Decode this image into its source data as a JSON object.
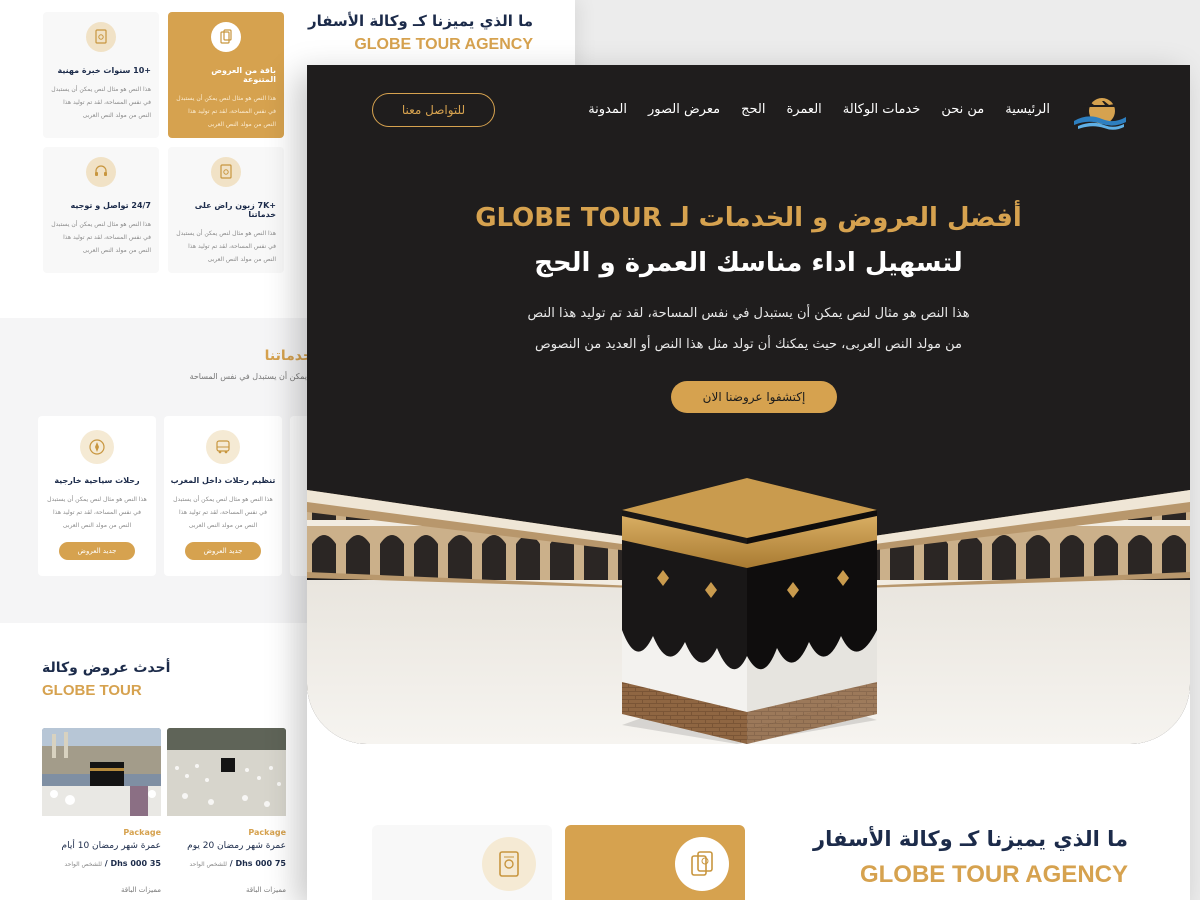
{
  "colors": {
    "gold": "#d6a24f",
    "navy": "#1c2b4a",
    "hero_bg": "#1f1d1d"
  },
  "back_page": {
    "why": {
      "title": "ما الذي يميزنا كـ وكالة الأسفار",
      "brand": "GLOBE TOUR AGENCY"
    },
    "features": [
      {
        "title": "+10  سنوات خبرة مهنية",
        "desc": "هذا النص هو مثال لنص يمكن أن يستبدل في نفس المساحة، لقد تم توليد هذا النص من مولد النص العربى",
        "icon": "certificate-icon"
      },
      {
        "title": "باقة من العروض المتنوعة",
        "desc": "هذا النص هو مثال لنص يمكن أن يستبدل في نفس المساحة، لقد تم توليد هذا النص من مولد النص العربى",
        "icon": "travel-docs-icon"
      },
      {
        "title": "24/7  تواصل و توجيه",
        "desc": "هذا النص هو مثال لنص يمكن أن يستبدل في نفس المساحة، لقد تم توليد هذا النص من مولد النص العربى",
        "icon": "support-headset-icon"
      },
      {
        "title": "+7K  زبون راض على خدماتنا",
        "desc": "هذا النص هو مثال لنص يمكن أن يستبدل في نفس المساحة، لقد تم توليد هذا النص من مولد النص العربى",
        "icon": "certificate-icon"
      }
    ],
    "services": {
      "title": "خدماتنا",
      "subtitle": "يمكن أن يستبدل في نفس المساحة",
      "items": [
        {
          "title": "رحلات سياحية خارجية",
          "desc": "هذا النص هو مثال لنص يمكن أن يستبدل في نفس المساحة، لقد تم توليد هذا النص من مولد النص العربى",
          "button": "جديد العروض",
          "icon": "compass-icon"
        },
        {
          "title": "تنظيم رحلات داخل المغرب",
          "desc": "هذا النص هو مثال لنص يمكن أن يستبدل في نفس المساحة، لقد تم توليد هذا النص من مولد النص العربى",
          "button": "جديد العروض",
          "icon": "bus-icon"
        }
      ]
    },
    "latest": {
      "title": "أحدث عروض وكالة",
      "brand": "GLOBE TOUR",
      "packages": [
        {
          "tag": "Package",
          "title": "عمرة شهر رمضان 10 أيام",
          "price": "35 000 Dhs /",
          "price_note": "للشخص الواحد",
          "footer": "مميزات الباقة"
        },
        {
          "tag": "Package",
          "title": "عمرة شهر رمضان 20 يوم",
          "price": "75 000 Dhs /",
          "price_note": "للشخص الواحد",
          "footer": "مميزات الباقة"
        }
      ]
    }
  },
  "front_page": {
    "logo": "globe-tour-logo",
    "nav": [
      "الرئيسية",
      "من نحن",
      "خدمات الوكالة",
      "العمرة",
      "الحج",
      "معرض الصور",
      "المدونة"
    ],
    "contact_button": "للتواصل معنا",
    "hero": {
      "title_line1": "أفضل العروض و الخدمات لـ GLOBE TOUR",
      "title_line2": "لتسهيل اداء مناسك العمرة و الحج",
      "desc_line1": "هذا النص هو مثال لنص يمكن أن يستبدل في نفس المساحة، لقد تم توليد هذا النص",
      "desc_line2": "من مولد النص العربى، حيث يمكنك أن تولد مثل هذا النص أو العديد من النصوص",
      "cta": "إكتشفوا عروضنا الان"
    },
    "why": {
      "title": "ما الذي يميزنا كـ وكالة الأسفار",
      "brand": "GLOBE TOUR AGENCY"
    }
  }
}
